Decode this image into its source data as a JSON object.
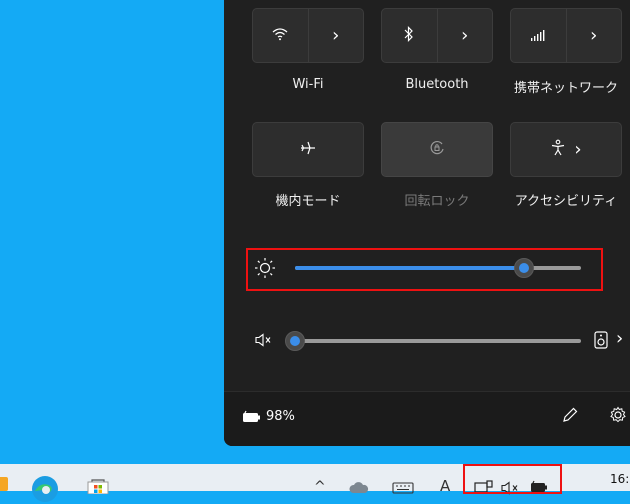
{
  "quick_settings": {
    "wifi": {
      "label": "Wi-Fi"
    },
    "bluetooth": {
      "label": "Bluetooth"
    },
    "cellular": {
      "label": "携帯ネットワーク"
    },
    "airplane": {
      "label": "機内モード"
    },
    "rotation_lock": {
      "label": "回転ロック",
      "enabled": false
    },
    "accessibility": {
      "label": "アクセシビリティ"
    }
  },
  "brightness": {
    "level_percent": 80
  },
  "volume": {
    "level_percent": 0,
    "muted": true
  },
  "battery": {
    "percent_label": "98%"
  },
  "clock": {
    "time": "16:"
  },
  "colors": {
    "accent": "#3b8eea",
    "desktop": "#14aaf5",
    "panel": "#202020",
    "highlight": "#e11111"
  }
}
